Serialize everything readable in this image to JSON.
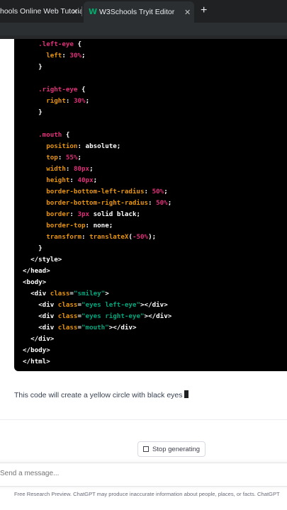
{
  "browser": {
    "tabs": [
      {
        "title": "hools Online Web Tutorials",
        "close": "✕"
      },
      {
        "title": "W3Schools Tryit Editor",
        "close": "✕",
        "icon_letter": "W"
      }
    ],
    "new_tab": "+"
  },
  "code_block": {
    "lines": [
      [
        {
          "t": "    "
        },
        {
          "t": ".left-eye",
          "c": "sel"
        },
        {
          "t": " {"
        }
      ],
      [
        {
          "t": "      "
        },
        {
          "t": "left",
          "c": "prop"
        },
        {
          "t": ": "
        },
        {
          "t": "30%",
          "c": "val"
        },
        {
          "t": ";"
        }
      ],
      [
        {
          "t": "    }"
        }
      ],
      [
        {
          "t": ""
        }
      ],
      [
        {
          "t": "    "
        },
        {
          "t": ".right-eye",
          "c": "sel"
        },
        {
          "t": " {"
        }
      ],
      [
        {
          "t": "      "
        },
        {
          "t": "right",
          "c": "prop"
        },
        {
          "t": ": "
        },
        {
          "t": "30%",
          "c": "val"
        },
        {
          "t": ";"
        }
      ],
      [
        {
          "t": "    }"
        }
      ],
      [
        {
          "t": ""
        }
      ],
      [
        {
          "t": "    "
        },
        {
          "t": ".mouth",
          "c": "sel"
        },
        {
          "t": " {"
        }
      ],
      [
        {
          "t": "      "
        },
        {
          "t": "position",
          "c": "prop"
        },
        {
          "t": ": absolute;"
        }
      ],
      [
        {
          "t": "      "
        },
        {
          "t": "top",
          "c": "prop"
        },
        {
          "t": ": "
        },
        {
          "t": "55%",
          "c": "val"
        },
        {
          "t": ";"
        }
      ],
      [
        {
          "t": "      "
        },
        {
          "t": "width",
          "c": "prop"
        },
        {
          "t": ": "
        },
        {
          "t": "80px",
          "c": "val"
        },
        {
          "t": ";"
        }
      ],
      [
        {
          "t": "      "
        },
        {
          "t": "height",
          "c": "prop"
        },
        {
          "t": ": "
        },
        {
          "t": "40px",
          "c": "val"
        },
        {
          "t": ";"
        }
      ],
      [
        {
          "t": "      "
        },
        {
          "t": "border-bottom-left-radius",
          "c": "prop"
        },
        {
          "t": ": "
        },
        {
          "t": "50%",
          "c": "val"
        },
        {
          "t": ";"
        }
      ],
      [
        {
          "t": "      "
        },
        {
          "t": "border-bottom-right-radius",
          "c": "prop"
        },
        {
          "t": ": "
        },
        {
          "t": "50%",
          "c": "val"
        },
        {
          "t": ";"
        }
      ],
      [
        {
          "t": "      "
        },
        {
          "t": "border",
          "c": "prop"
        },
        {
          "t": ": "
        },
        {
          "t": "3px",
          "c": "val"
        },
        {
          "t": " solid black;"
        }
      ],
      [
        {
          "t": "      "
        },
        {
          "t": "border-top",
          "c": "prop"
        },
        {
          "t": ": none;"
        }
      ],
      [
        {
          "t": "      "
        },
        {
          "t": "transform",
          "c": "prop"
        },
        {
          "t": ": "
        },
        {
          "t": "translateX",
          "c": "fn"
        },
        {
          "t": "("
        },
        {
          "t": "-50%",
          "c": "val"
        },
        {
          "t": ");"
        }
      ],
      [
        {
          "t": "    }"
        }
      ],
      [
        {
          "t": "  </style>"
        }
      ],
      [
        {
          "t": "</head>"
        }
      ],
      [
        {
          "t": "<body>"
        }
      ],
      [
        {
          "t": "  <div "
        },
        {
          "t": "class",
          "c": "attr"
        },
        {
          "t": "="
        },
        {
          "t": "\"smiley\"",
          "c": "str"
        },
        {
          "t": ">"
        }
      ],
      [
        {
          "t": "    <div "
        },
        {
          "t": "class",
          "c": "attr"
        },
        {
          "t": "="
        },
        {
          "t": "\"eyes left-eye\"",
          "c": "str"
        },
        {
          "t": "></div>"
        }
      ],
      [
        {
          "t": "    <div "
        },
        {
          "t": "class",
          "c": "attr"
        },
        {
          "t": "="
        },
        {
          "t": "\"eyes right-eye\"",
          "c": "str"
        },
        {
          "t": "></div>"
        }
      ],
      [
        {
          "t": "    <div "
        },
        {
          "t": "class",
          "c": "attr"
        },
        {
          "t": "="
        },
        {
          "t": "\"mouth\"",
          "c": "str"
        },
        {
          "t": "></div>"
        }
      ],
      [
        {
          "t": "  </div>"
        }
      ],
      [
        {
          "t": "</body>"
        }
      ],
      [
        {
          "t": "</html>"
        }
      ]
    ]
  },
  "message": {
    "text": "This code will create a yellow circle with black eyes"
  },
  "controls": {
    "stop_label": "Stop generating"
  },
  "composer": {
    "placeholder": "Send a message..."
  },
  "footer": {
    "text": "Free Research Preview. ChatGPT may produce inaccurate information about people, places, or facts. ChatGPT"
  },
  "colors": {
    "selector": "#df3079",
    "property": "#e9950c",
    "string": "#00a67d",
    "code_bg": "#000000"
  }
}
